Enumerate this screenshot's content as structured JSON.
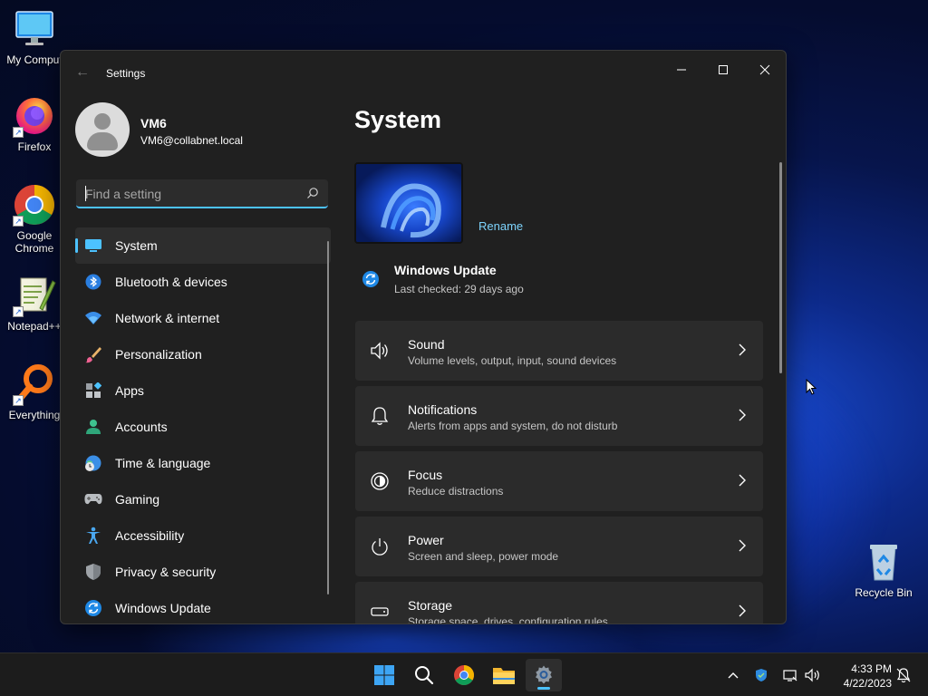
{
  "desktop": {
    "icons": [
      {
        "label": "My Comput"
      },
      {
        "label": "Firefox"
      },
      {
        "label": "Google Chrome"
      },
      {
        "label": "Notepad++"
      },
      {
        "label": "Everything"
      },
      {
        "label": "Recycle Bin"
      }
    ]
  },
  "window": {
    "title": "Settings",
    "controls": [
      "minimize",
      "maximize",
      "close"
    ]
  },
  "profile": {
    "name": "VM6",
    "email": "VM6@collabnet.local"
  },
  "search": {
    "placeholder": "Find a setting",
    "value": ""
  },
  "sidebar": {
    "items": [
      {
        "label": "System",
        "icon": "monitor-icon",
        "active": true
      },
      {
        "label": "Bluetooth & devices",
        "icon": "bluetooth-icon"
      },
      {
        "label": "Network & internet",
        "icon": "wifi-icon"
      },
      {
        "label": "Personalization",
        "icon": "brush-icon"
      },
      {
        "label": "Apps",
        "icon": "apps-icon"
      },
      {
        "label": "Accounts",
        "icon": "person-icon"
      },
      {
        "label": "Time & language",
        "icon": "globe-clock-icon"
      },
      {
        "label": "Gaming",
        "icon": "gamepad-icon"
      },
      {
        "label": "Accessibility",
        "icon": "accessibility-icon"
      },
      {
        "label": "Privacy & security",
        "icon": "shield-icon"
      },
      {
        "label": "Windows Update",
        "icon": "sync-icon"
      }
    ]
  },
  "main": {
    "title": "System",
    "rename_label": "Rename",
    "windows_update": {
      "title": "Windows Update",
      "subtitle": "Last checked: 29 days ago"
    },
    "cards": [
      {
        "title": "Sound",
        "subtitle": "Volume levels, output, input, sound devices",
        "icon": "speaker-icon"
      },
      {
        "title": "Notifications",
        "subtitle": "Alerts from apps and system, do not disturb",
        "icon": "bell-icon"
      },
      {
        "title": "Focus",
        "subtitle": "Reduce distractions",
        "icon": "focus-icon"
      },
      {
        "title": "Power",
        "subtitle": "Screen and sleep, power mode",
        "icon": "power-icon"
      },
      {
        "title": "Storage",
        "subtitle": "Storage space, drives, configuration rules",
        "icon": "storage-icon"
      }
    ]
  },
  "taskbar": {
    "apps": [
      {
        "name": "start-button"
      },
      {
        "name": "search-button"
      },
      {
        "name": "chrome-button"
      },
      {
        "name": "file-explorer-button"
      },
      {
        "name": "settings-button",
        "active": true
      }
    ],
    "clock": {
      "time": "4:33 PM",
      "date": "4/22/2023"
    }
  },
  "colors": {
    "accent": "#4cc2ff",
    "window_bg": "#202020",
    "card_bg": "#2b2b2b",
    "link": "#7dd3fc"
  }
}
